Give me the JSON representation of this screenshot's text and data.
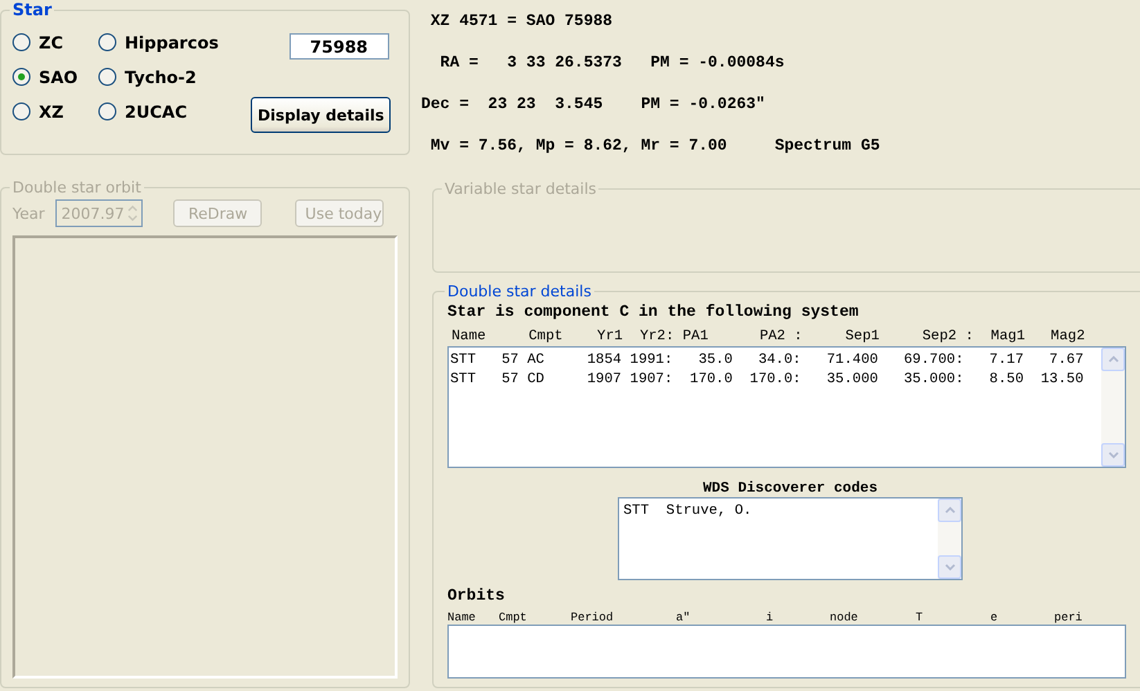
{
  "star": {
    "legend": "Star",
    "catalogs": [
      {
        "label": "ZC",
        "selected": false
      },
      {
        "label": "SAO",
        "selected": true
      },
      {
        "label": "XZ",
        "selected": false
      },
      {
        "label": "Hipparcos",
        "selected": false
      },
      {
        "label": "Tycho-2",
        "selected": false
      },
      {
        "label": "2UCAC",
        "selected": false
      }
    ],
    "number_field": {
      "value": "75988"
    },
    "display_button": "Display details"
  },
  "info_lines": [
    " XZ 4571 = SAO 75988",
    "  RA =   3 33 26.5373   PM = -0.00084s",
    "Dec =  23 23  3.545    PM = -0.0263\"",
    " Mv = 7.56, Mp = 8.62, Mr = 7.00     Spectrum G5"
  ],
  "orbit_panel": {
    "legend": "Double star orbit",
    "disabled": true,
    "year_label": "Year",
    "year_value": "2007.97",
    "redraw_button": "ReDraw",
    "use_today_button": "Use today"
  },
  "variable_panel": {
    "legend": "Variable star details",
    "disabled": true
  },
  "double_panel": {
    "legend": "Double star details",
    "disabled": false,
    "heading": "Star is component C in the following system",
    "table_header": "Name     Cmpt    Yr1  Yr2: PA1      PA2 :     Sep1     Sep2 :  Mag1   Mag2",
    "rows": [
      "STT   57 AC     1854 1991:   35.0   34.0:   71.400   69.700:   7.17   7.67",
      "STT   57 CD     1907 1907:  170.0  170.0:   35.000   35.000:   8.50  13.50"
    ],
    "wds": {
      "title": "WDS Discoverer codes",
      "entries": [
        "STT  Struve, O."
      ]
    },
    "orbits": {
      "title": "Orbits",
      "columns": [
        "Name",
        "Cmpt",
        "Period",
        "a\"",
        "i",
        "node",
        "T",
        "e",
        "peri"
      ]
    }
  }
}
